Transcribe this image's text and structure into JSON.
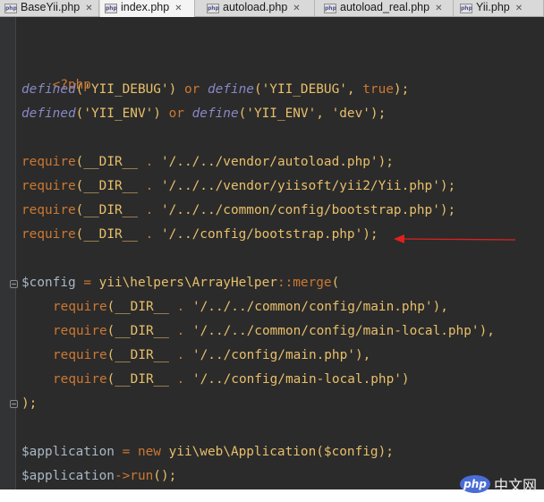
{
  "tabs": [
    {
      "label": "BaseYii.php",
      "icon": "php-file-icon",
      "active": false
    },
    {
      "label": "index.php",
      "icon": "php-file-icon",
      "active": true
    },
    {
      "label": "autoload.php",
      "icon": "php-file-icon",
      "active": false
    },
    {
      "label": "autoload_real.php",
      "icon": "php-file-icon",
      "active": false
    },
    {
      "label": "Yii.php",
      "icon": "php-file-icon",
      "active": false
    }
  ],
  "tab_icon_text": "php",
  "tab_close_glyph": "✕",
  "code": {
    "open_tag": "<?php",
    "line_debug": {
      "fn1": "defined",
      "s1": "('YII_DEBUG')",
      "or": "or",
      "fn2": "define",
      "s2": "('YII_DEBUG', ",
      "true": "true",
      "end": ");"
    },
    "line_env": {
      "fn1": "defined",
      "s1": "('YII_ENV')",
      "or": "or",
      "fn2": "define",
      "s2": "('YII_ENV', ",
      "val": "'dev'",
      "end": ");"
    },
    "requires": [
      {
        "kw": "require",
        "open": "(",
        "dir": "__DIR__",
        "dot": " . ",
        "path": "'/../../vendor/autoload.php'",
        "close": ");"
      },
      {
        "kw": "require",
        "open": "(",
        "dir": "__DIR__",
        "dot": " . ",
        "path": "'/../../vendor/yiisoft/yii2/Yii.php'",
        "close": ");"
      },
      {
        "kw": "require",
        "open": "(",
        "dir": "__DIR__",
        "dot": " . ",
        "path": "'/../../common/config/bootstrap.php'",
        "close": ");"
      },
      {
        "kw": "require",
        "open": "(",
        "dir": "__DIR__",
        "dot": " . ",
        "path": "'/../config/bootstrap.php'",
        "close": ");"
      }
    ],
    "config_line": {
      "var": "$config",
      "eq": " = ",
      "cls": "yii\\helpers\\ArrayHelper",
      "dc": "::",
      "method": "merge",
      "paren": "("
    },
    "merge_args": [
      {
        "kw": "require",
        "open": "(",
        "dir": "__DIR__",
        "dot": " . ",
        "path": "'/../../common/config/main.php'",
        "close": "),"
      },
      {
        "kw": "require",
        "open": "(",
        "dir": "__DIR__",
        "dot": " . ",
        "path": "'/../../common/config/main-local.php'",
        "close": "),"
      },
      {
        "kw": "require",
        "open": "(",
        "dir": "__DIR__",
        "dot": " . ",
        "path": "'/../config/main.php'",
        "close": "),"
      },
      {
        "kw": "require",
        "open": "(",
        "dir": "__DIR__",
        "dot": " . ",
        "path": "'/../config/main-local.php'",
        "close": ")"
      }
    ],
    "merge_close": ");",
    "app_line": {
      "var": "$application",
      "eq": " = ",
      "new": "new",
      "cls": " yii\\web\\Application(",
      "arg": "$config",
      "end": ");"
    },
    "run_line": {
      "var": "$application",
      "arrow": "->",
      "method": "run",
      "end": "();"
    }
  },
  "watermark": {
    "logo_text": "php",
    "text": "中文网"
  },
  "colors": {
    "keyword": "#cc7832",
    "string": "#e8bf6a",
    "function": "#8888c6",
    "arrow": "#e02020",
    "background": "#2b2b2b"
  }
}
